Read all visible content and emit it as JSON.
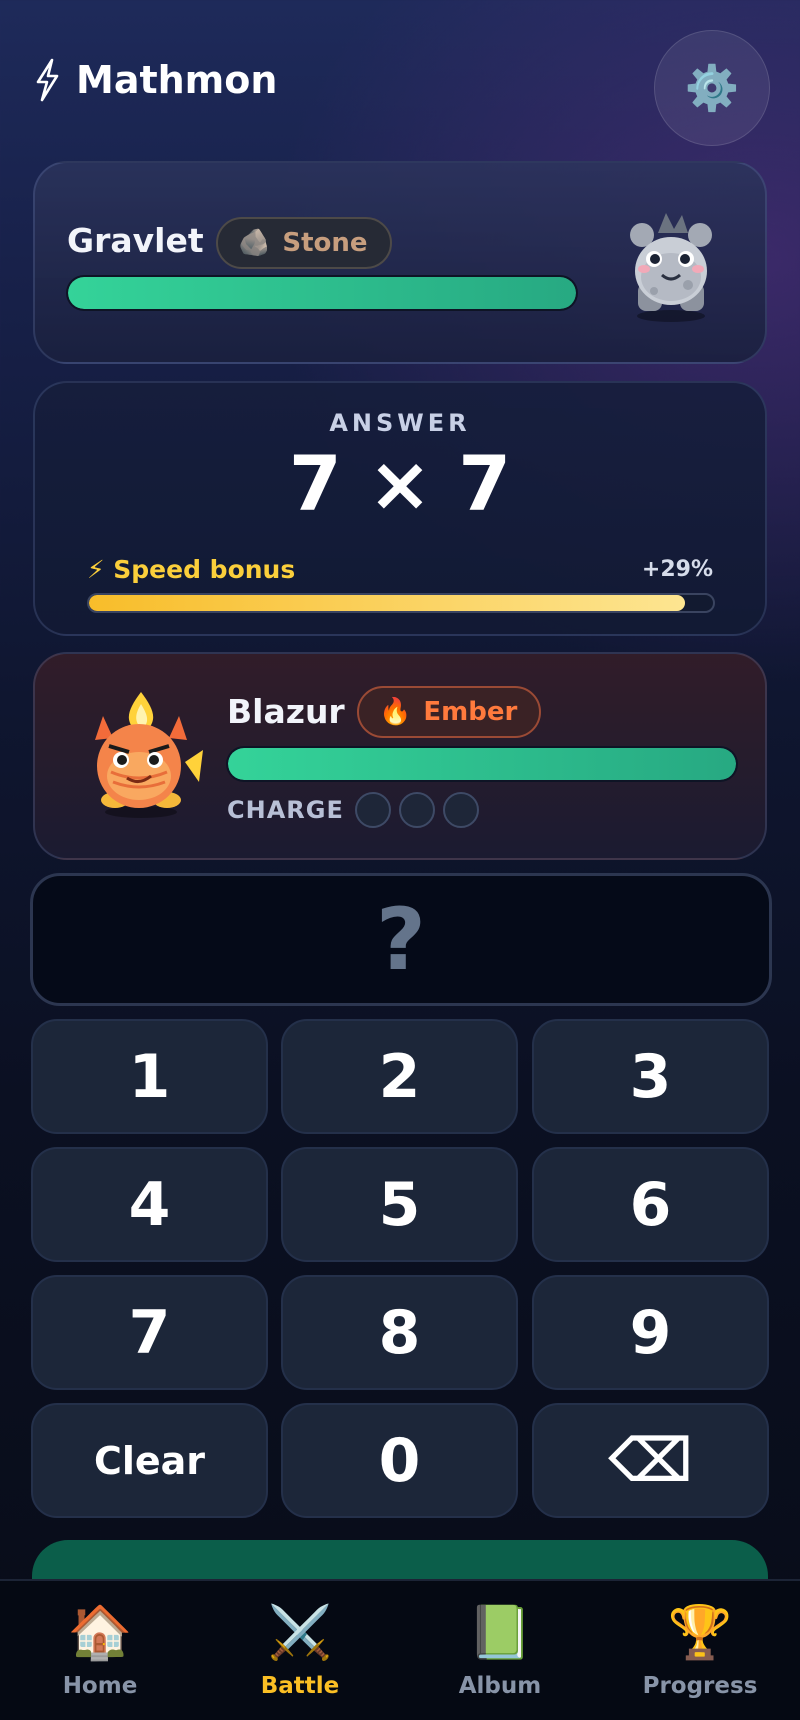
{
  "app": {
    "title": "Mathmon"
  },
  "header": {
    "settings_icon": "⚙️"
  },
  "enemy": {
    "name": "Gravlet",
    "type_icon": "🪨",
    "type_label": "Stone",
    "hp_fraction": 1.0,
    "monster_icon": "stone-monster"
  },
  "question": {
    "label": "ANSWER",
    "problem": "7 × 7",
    "speed_label": "⚡ Speed bonus",
    "speed_value": "+29%",
    "speed_fraction": 0.955
  },
  "player": {
    "name": "Blazur",
    "type_icon": "🔥",
    "type_label": "Ember",
    "hp_fraction": 1.0,
    "charge_label": "CHARGE",
    "charge_filled": 0,
    "charge_total": 3,
    "monster_icon": "fire-monster"
  },
  "answer_display": "?",
  "keypad": {
    "keys": [
      "1",
      "2",
      "3",
      "4",
      "5",
      "6",
      "7",
      "8",
      "9",
      "Clear",
      "0",
      "⌫"
    ]
  },
  "nav": {
    "items": [
      {
        "icon": "🏠",
        "label": "Home",
        "active": false
      },
      {
        "icon": "⚔️",
        "label": "Battle",
        "active": true
      },
      {
        "icon": "📗",
        "label": "Album",
        "active": false
      },
      {
        "icon": "🏆",
        "label": "Progress",
        "active": false
      }
    ]
  }
}
